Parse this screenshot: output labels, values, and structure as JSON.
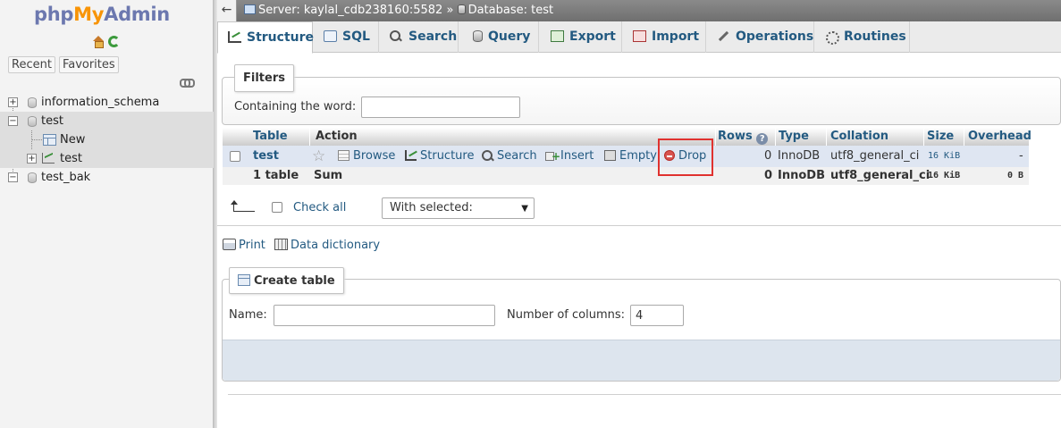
{
  "logo": {
    "part1": "php",
    "part2": "My",
    "part3": "Admin"
  },
  "sidebar": {
    "recent_label": "Recent",
    "favorites_label": "Favorites",
    "tree": [
      {
        "label": "information_schema"
      },
      {
        "label": "test"
      },
      {
        "label": "New"
      },
      {
        "label": "test"
      },
      {
        "label": "test_bak"
      }
    ]
  },
  "breadcrumb": {
    "server": "Server: kaylal_cdb238160:5582",
    "separator": "»",
    "database": "Database: test"
  },
  "tabs": [
    {
      "label": "Structure",
      "icon": "structure-icon"
    },
    {
      "label": "SQL",
      "icon": "sql-icon"
    },
    {
      "label": "Search",
      "icon": "search-icon"
    },
    {
      "label": "Query",
      "icon": "query-icon"
    },
    {
      "label": "Export",
      "icon": "export-icon"
    },
    {
      "label": "Import",
      "icon": "import-icon"
    },
    {
      "label": "Operations",
      "icon": "operations-icon"
    },
    {
      "label": "Routines",
      "icon": "routines-icon"
    }
  ],
  "filters": {
    "legend": "Filters",
    "label": "Containing the word:",
    "value": ""
  },
  "table": {
    "headers": {
      "table": "Table",
      "action": "Action",
      "rows": "Rows",
      "type": "Type",
      "collation": "Collation",
      "size": "Size",
      "overhead": "Overhead"
    },
    "row": {
      "name": "test",
      "browse": "Browse",
      "structure": "Structure",
      "search": "Search",
      "insert": "Insert",
      "empty": "Empty",
      "drop": "Drop",
      "rows": "0",
      "type": "InnoDB",
      "collation": "utf8_general_ci",
      "size": "16 KiB",
      "overhead": "-"
    },
    "summary": {
      "name": "1 table",
      "action": "Sum",
      "rows": "0",
      "type": "InnoDB",
      "collation": "utf8_general_ci",
      "size": "16 KiB",
      "overhead": "0 B"
    }
  },
  "bulk": {
    "check_all": "Check all",
    "with_selected": "With selected:"
  },
  "links": {
    "print": "Print",
    "data_dictionary": "Data dictionary"
  },
  "create_table": {
    "legend": "Create table",
    "name_label": "Name:",
    "name_value": "",
    "columns_label": "Number of columns:",
    "columns_value": "4"
  },
  "colors": {
    "link": "#235a81",
    "highlight": "#e0322f",
    "row_bg": "#dfe6f2"
  }
}
